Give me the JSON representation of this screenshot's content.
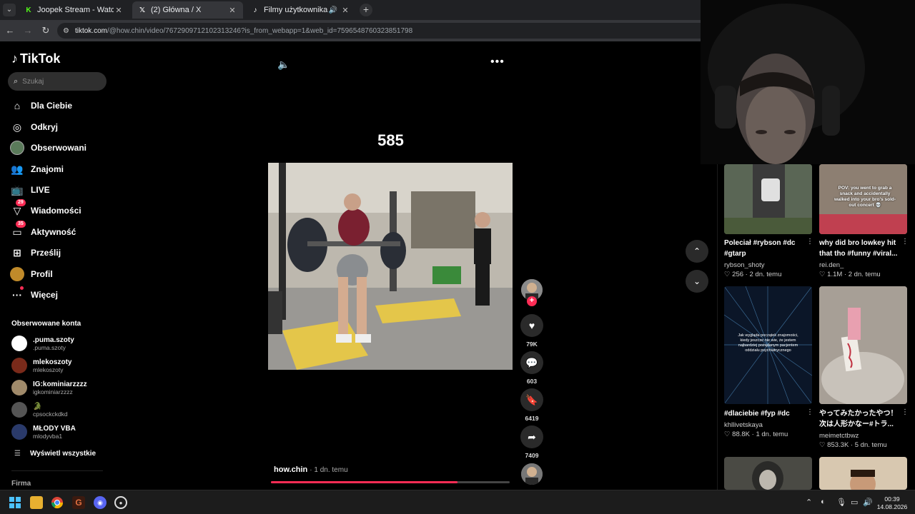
{
  "browser": {
    "tabs": [
      {
        "title": "Joopek Stream - Watch Live on",
        "icon": "kick-icon"
      },
      {
        "title": "(2) Główna / X",
        "icon": "x-icon"
      },
      {
        "title": "Filmy użytkownika hao che",
        "icon": "tiktok-icon"
      }
    ],
    "url_domain": "tiktok.com",
    "url_path": "/@how.chin/video/7672909712102313246?is_from_webapp=1&web_id=7596548760323851798"
  },
  "sidebar": {
    "logo": "TikTok",
    "search_placeholder": "Szukaj",
    "nav": [
      {
        "label": "Dla Ciebie",
        "icon": "home-icon"
      },
      {
        "label": "Odkryj",
        "icon": "compass-icon"
      },
      {
        "label": "Obserwowani",
        "icon": "following-avatar-icon"
      },
      {
        "label": "Znajomi",
        "icon": "friends-icon"
      },
      {
        "label": "LIVE",
        "icon": "live-icon"
      },
      {
        "label": "Wiadomości",
        "icon": "messages-icon",
        "badge": "29"
      },
      {
        "label": "Aktywność",
        "icon": "activity-icon",
        "badge": "35"
      },
      {
        "label": "Prześlij",
        "icon": "upload-icon"
      },
      {
        "label": "Profil",
        "icon": "profile-avatar-icon"
      },
      {
        "label": "Więcej",
        "icon": "more-dots-icon"
      }
    ],
    "followed_header": "Obserwowane konta",
    "followed": [
      {
        "name": ".puma.szoty",
        "user": ".puma.szoty"
      },
      {
        "name": "mlekoszoty",
        "user": "mlekoszoty"
      },
      {
        "name": "IG:kominiarzzzz",
        "user": "igkominiarzzzz"
      },
      {
        "name": "🐊",
        "user": "cpsockckdkd"
      },
      {
        "name": "MŁODY VBA",
        "user": "mlodyvba1"
      }
    ],
    "show_all": "Wyświetl wszystkie",
    "footer_section": "Firma"
  },
  "video": {
    "caption": "585",
    "author": "how.chin",
    "date": "· 1 dn. temu",
    "progress": 0.78,
    "likes": "79K",
    "comments": "603",
    "saves": "6419",
    "shares": "7409"
  },
  "recommendations": [
    {
      "title": "Poleciał #rybson #dc #gtarp",
      "user": "rybson_shoty",
      "likes": "256",
      "date": "2 dn. temu",
      "thumb_color": "#5b6a56"
    },
    {
      "title": "why did bro lowkey hit that tho #funny #viral...",
      "user": "rei.den_",
      "likes": "1.1M",
      "date": "2 dn. temu",
      "thumb_color": "#8a7a6e",
      "overlay": "POV: you went to grab a snack and accidentally walked into your bro's sold-out concert 💀"
    },
    {
      "title": "#dlaciebie #fyp #dc",
      "user": "khllivetskaya",
      "likes": "88.8K",
      "date": "1 dn. temu",
      "thumb_color": "#0b1628",
      "overlay": "Jak wygląda początek znajomości, kiedy jeszcze nie wie, że jestem najbardziej pożądanym pacjentem oddziału psychiatrycznego"
    },
    {
      "title": "やってみたかったやつ！次は人形かなー#トラ...",
      "user": "meimetctbwz",
      "likes": "853.3K",
      "date": "5 dn. temu",
      "thumb_color": "#9c948c"
    }
  ],
  "taskbar": {
    "time": "00:39",
    "date": "14.08.2026"
  },
  "colors": {
    "accent": "#fe2c55",
    "sidebar_bg": "#000000",
    "chrome_bg": "#202124"
  }
}
